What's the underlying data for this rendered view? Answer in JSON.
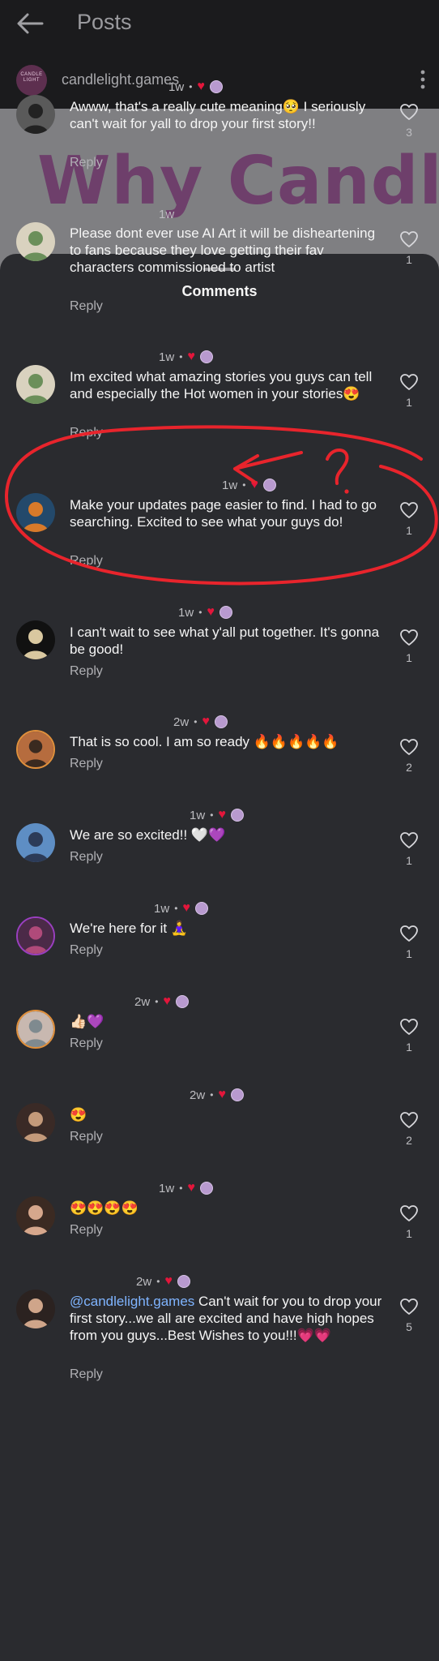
{
  "header": {
    "title": "Posts",
    "back_icon": "arrow-left-icon",
    "more_icon": "vertical-dots-icon"
  },
  "account": {
    "name": "candlelight.games",
    "logo_text": "CANDLE LIGHT"
  },
  "post_preview": {
    "text": "Why Candlelight?"
  },
  "sheet": {
    "title": "Comments"
  },
  "comments": [
    {
      "age": "1w",
      "text": "Awww, that's a really cute meaning🥺 I seriously can't wait for yall to drop your first story!!",
      "reply": "Reply",
      "likes": "3",
      "author_hearted": true
    },
    {
      "age": "1w",
      "text": "Please dont ever use AI Art it will be disheartening to fans because they love getting their fav characters commissioned to artist",
      "reply": "Reply",
      "likes": "1",
      "author_hearted": false
    },
    {
      "age": "1w",
      "text": "Im excited what amazing stories you guys can tell and especially the Hot women in your stories😍",
      "reply": "Reply",
      "likes": "1",
      "author_hearted": true
    },
    {
      "age": "1w",
      "text": "Make your updates page easier to find. I had to go searching. Excited to see what your guys do!",
      "reply": "Reply",
      "likes": "1",
      "author_hearted": true
    },
    {
      "age": "1w",
      "text": "I can't wait to see what y'all put together.  It's gonna be good!",
      "reply": "Reply",
      "likes": "1",
      "author_hearted": true
    },
    {
      "age": "2w",
      "text": "That is so cool. I am so ready 🔥🔥🔥🔥🔥",
      "reply": "Reply",
      "likes": "2",
      "author_hearted": true
    },
    {
      "age": "1w",
      "text": "We are so excited!! 🤍💜",
      "reply": "Reply",
      "likes": "1",
      "author_hearted": true
    },
    {
      "age": "1w",
      "text": "We're here for it 🧘‍♀️",
      "reply": "Reply",
      "likes": "1",
      "author_hearted": true
    },
    {
      "age": "2w",
      "text": "👍🏻💜",
      "reply": "Reply",
      "likes": "1",
      "author_hearted": true
    },
    {
      "age": "2w",
      "text": "😍",
      "reply": "Reply",
      "likes": "2",
      "author_hearted": true
    },
    {
      "age": "1w",
      "text": "😍😍😍😍",
      "reply": "Reply",
      "likes": "1",
      "author_hearted": true
    },
    {
      "age": "2w",
      "mention": "@candlelight.games",
      "text": " Can't wait for you to drop your first story...we all are excited and have high hopes from you guys...Best Wishes to you!!!💗💗",
      "reply": "Reply",
      "likes": "5",
      "author_hearted": true
    }
  ],
  "colors": {
    "accent_heart": "#e3163b",
    "annotation": "#e8242c",
    "mention": "#7fb4ff",
    "background": "#2a2b2f"
  },
  "icons": {
    "like": "heart-outline-icon",
    "author_like": "red-heart-icon"
  }
}
